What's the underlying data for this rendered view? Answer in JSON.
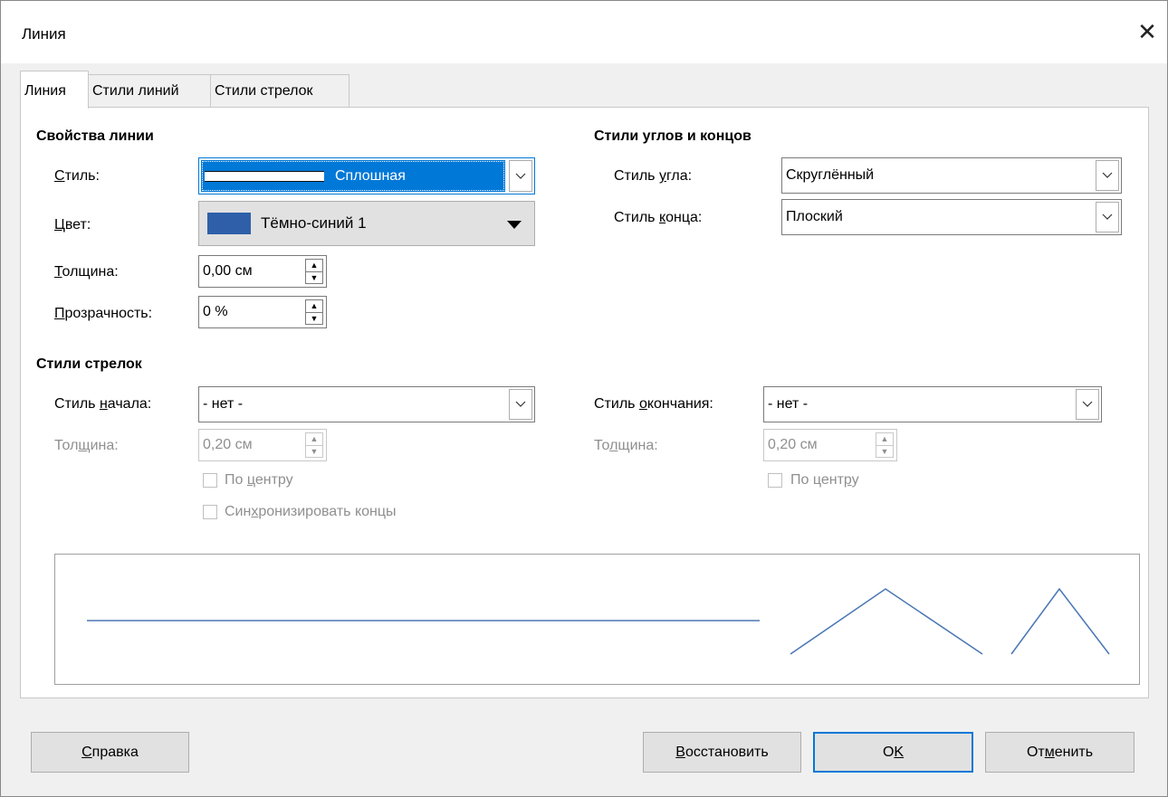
{
  "window": {
    "title": "Линия",
    "close_glyph": "✕"
  },
  "tabs": [
    {
      "label": "Линия"
    },
    {
      "label": "Стили линий"
    },
    {
      "label": "Стили стрелок"
    }
  ],
  "line_props": {
    "heading": "Свойства линии",
    "style_label": "Стиль:",
    "style_value": "Сплошная",
    "color_label": "Цвет:",
    "color_value": "Тёмно-синий 1",
    "color_swatch": "#2e5fa8",
    "width_label": "Толщина:",
    "width_value": "0,00 см",
    "transparency_label": "Прозрачность:",
    "transparency_value": "0 %"
  },
  "corner_styles": {
    "heading": "Стили углов и концов",
    "corner_label": "Стиль угла:",
    "corner_value": "Скруглённый",
    "cap_label": "Стиль конца:",
    "cap_value": "Плоский"
  },
  "arrow_styles": {
    "heading": "Стили стрелок",
    "start_label": "Стиль начала:",
    "start_value": "- нет -",
    "end_label": "Стиль окончания:",
    "end_value": "- нет -",
    "start_width_label": "Толщина:",
    "start_width_value": "0,20 см",
    "end_width_label": "Толщина:",
    "end_width_value": "0,20 см",
    "start_center_label": "По центру",
    "end_center_label": "По центру",
    "sync_label": "Синхронизировать концы"
  },
  "preview": {
    "line_color": "#4a77b4"
  },
  "buttons": {
    "help": "Справка",
    "reset": "Восстановить",
    "ok": "OK",
    "cancel": "Отменить"
  }
}
